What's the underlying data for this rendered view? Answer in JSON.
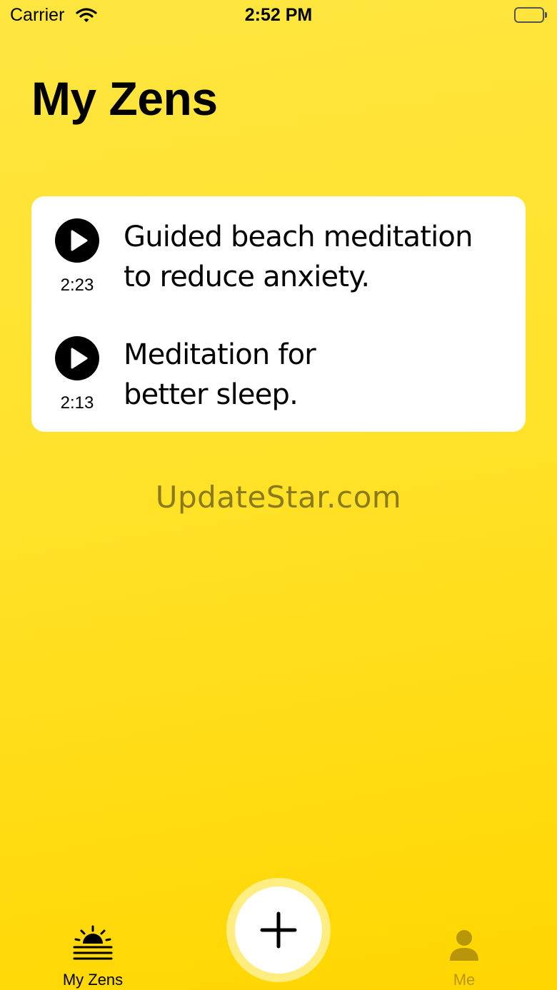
{
  "status_bar": {
    "carrier": "Carrier",
    "time": "2:52 PM"
  },
  "page": {
    "title": "My Zens"
  },
  "zens": [
    {
      "title_line1": "Guided beach meditation",
      "title_line2": "to reduce anxiety.",
      "duration": "2:23"
    },
    {
      "title_line1": "Meditation for",
      "title_line2": "better sleep.",
      "duration": "2:13"
    }
  ],
  "watermark": "UpdateStar.com",
  "tab_bar": {
    "tabs": [
      {
        "label": "My Zens",
        "icon": "sunrise-icon",
        "active": true
      },
      {
        "label": "Me",
        "icon": "person-icon",
        "active": false
      }
    ],
    "add_icon": "plus-icon"
  },
  "colors": {
    "background": "#ffe22b",
    "card": "#ffffff",
    "active_tab": "#000000",
    "inactive_tab": "#b8960a",
    "watermark": "#8a7a1c"
  }
}
